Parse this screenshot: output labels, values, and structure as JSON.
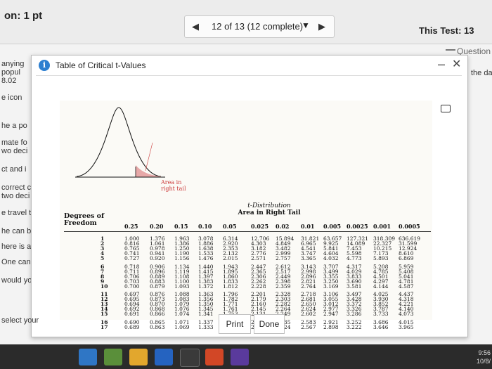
{
  "header": {
    "score": "on: 1 pt",
    "nav_label": "12 of 13 (12 complete)",
    "test_title": "This Test: 13",
    "help_link": "Question"
  },
  "left_fragments": [
    "anying",
    "popul",
    "8.02",
    "e icon",
    "he a po",
    "mate fo",
    "wo deci",
    "ct and i",
    "correct c",
    "two deci",
    "e travel t",
    "he can be",
    "here is a",
    "One can be",
    "would you"
  ],
  "right_fragment": "the da",
  "dialog": {
    "title": "Table of Critical t-Values",
    "figure": {
      "area_label_line1": "Area in",
      "area_label_line2": "right tail",
      "dist_title_line1": "t-Distribution",
      "dist_title_line2": "Area in Right Tail",
      "dof_line1": "Degrees of",
      "dof_line2": "Freedom"
    },
    "columns": [
      "0.25",
      "0.20",
      "0.15",
      "0.10",
      "0.05",
      "0.025",
      "0.02",
      "0.01",
      "0.005",
      "0.0025",
      "0.001",
      "0.0005"
    ],
    "rows": [
      {
        "df": "1",
        "v": [
          "1.000",
          "1.376",
          "1.963",
          "3.078",
          "6.314",
          "12.706",
          "15.894",
          "31.821",
          "63.657",
          "127.321",
          "318.309",
          "636.619"
        ]
      },
      {
        "df": "2",
        "v": [
          "0.816",
          "1.061",
          "1.386",
          "1.886",
          "2.920",
          "4.303",
          "4.849",
          "6.965",
          "9.925",
          "14.089",
          "22.327",
          "31.599"
        ]
      },
      {
        "df": "3",
        "v": [
          "0.765",
          "0.978",
          "1.250",
          "1.638",
          "2.353",
          "3.182",
          "3.482",
          "4.541",
          "5.841",
          "7.453",
          "10.215",
          "12.924"
        ]
      },
      {
        "df": "4",
        "v": [
          "0.741",
          "0.941",
          "1.190",
          "1.533",
          "2.132",
          "2.776",
          "2.999",
          "3.747",
          "4.604",
          "5.598",
          "7.173",
          "8.610"
        ]
      },
      {
        "df": "5",
        "v": [
          "0.727",
          "0.920",
          "1.156",
          "1.476",
          "2.015",
          "2.571",
          "2.757",
          "3.365",
          "4.032",
          "4.773",
          "5.893",
          "6.869"
        ]
      },
      {
        "df": "6",
        "v": [
          "0.718",
          "0.906",
          "1.134",
          "1.440",
          "1.943",
          "2.447",
          "2.612",
          "3.143",
          "3.707",
          "4.317",
          "5.208",
          "5.959"
        ]
      },
      {
        "df": "7",
        "v": [
          "0.711",
          "0.896",
          "1.119",
          "1.415",
          "1.895",
          "2.365",
          "2.517",
          "2.998",
          "3.499",
          "4.029",
          "4.785",
          "5.408"
        ]
      },
      {
        "df": "8",
        "v": [
          "0.706",
          "0.889",
          "1.108",
          "1.397",
          "1.860",
          "2.306",
          "2.449",
          "2.896",
          "3.355",
          "3.833",
          "4.501",
          "5.041"
        ]
      },
      {
        "df": "9",
        "v": [
          "0.703",
          "0.883",
          "1.100",
          "1.383",
          "1.833",
          "2.262",
          "2.398",
          "2.821",
          "3.250",
          "3.690",
          "4.297",
          "4.781"
        ]
      },
      {
        "df": "10",
        "v": [
          "0.700",
          "0.879",
          "1.093",
          "1.372",
          "1.812",
          "2.228",
          "2.359",
          "2.764",
          "3.169",
          "3.581",
          "4.144",
          "4.587"
        ]
      },
      {
        "df": "11",
        "v": [
          "0.697",
          "0.876",
          "1.088",
          "1.363",
          "1.796",
          "2.201",
          "2.328",
          "2.718",
          "3.106",
          "3.497",
          "4.025",
          "4.437"
        ]
      },
      {
        "df": "12",
        "v": [
          "0.695",
          "0.873",
          "1.083",
          "1.356",
          "1.782",
          "2.179",
          "2.303",
          "2.681",
          "3.055",
          "3.428",
          "3.930",
          "4.318"
        ]
      },
      {
        "df": "13",
        "v": [
          "0.694",
          "0.870",
          "1.079",
          "1.350",
          "1.771",
          "2.160",
          "2.282",
          "2.650",
          "3.012",
          "3.372",
          "3.852",
          "4.221"
        ]
      },
      {
        "df": "14",
        "v": [
          "0.692",
          "0.868",
          "1.076",
          "1.345",
          "1.761",
          "2.145",
          "2.264",
          "2.624",
          "2.977",
          "3.326",
          "3.787",
          "4.140"
        ]
      },
      {
        "df": "15",
        "v": [
          "0.691",
          "0.866",
          "1.074",
          "1.341",
          "1.753",
          "2.131",
          "2.249",
          "2.602",
          "2.947",
          "3.286",
          "3.733",
          "4.073"
        ]
      },
      {
        "df": "16",
        "v": [
          "0.690",
          "0.865",
          "1.071",
          "1.337",
          "1.746",
          "2.120",
          "2.235",
          "2.583",
          "2.921",
          "3.252",
          "3.686",
          "4.015"
        ]
      },
      {
        "df": "17",
        "v": [
          "0.689",
          "0.863",
          "1.069",
          "1.333",
          "1.740",
          "2.110",
          "2.224",
          "2.567",
          "2.898",
          "3.222",
          "3.646",
          "3.965"
        ]
      }
    ],
    "print_label": "Print",
    "done_label": "Done"
  },
  "footer": {
    "left_fragment": "select your"
  },
  "taskbar": {
    "time": "9:56",
    "date": "10/8/"
  },
  "colors": {
    "info": "#2d7fd0",
    "area_label": "#cc3b3b"
  }
}
